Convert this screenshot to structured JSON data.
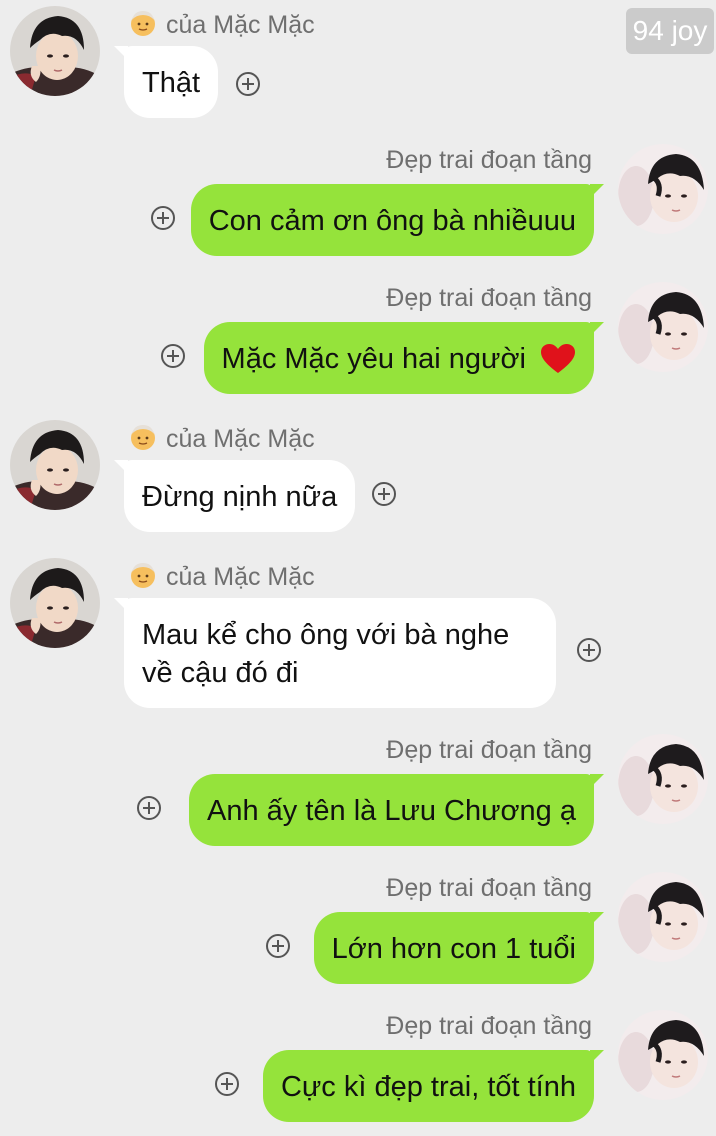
{
  "watermark": "94 joy",
  "senders": {
    "grandpa": "của Mặc Mặc",
    "me": "Đẹp trai đoạn tầng"
  },
  "icons": {
    "grandpa_emoji": "old-man-emoji",
    "heart": "red-heart-emoji",
    "plus": "add-circle-icon"
  },
  "colors": {
    "background": "#ededed",
    "incoming_bubble": "#ffffff",
    "outgoing_bubble": "#95e33b"
  },
  "messages": [
    {
      "side": "left",
      "sender": "của Mặc Mặc",
      "text": "Thật"
    },
    {
      "side": "right",
      "sender": "Đẹp trai đoạn tầng",
      "text": "Con cảm ơn ông bà nhiềuuu"
    },
    {
      "side": "right",
      "sender": "Đẹp trai đoạn tầng",
      "text": "Mặc Mặc yêu hai người"
    },
    {
      "side": "left",
      "sender": "của Mặc Mặc",
      "text": "Đừng nịnh nữa"
    },
    {
      "side": "left",
      "sender": "của Mặc Mặc",
      "text": "Mau kể cho ông với bà nghe về cậu đó đi"
    },
    {
      "side": "right",
      "sender": "Đẹp trai đoạn tầng",
      "text": "Anh ấy tên là Lưu Chương ạ"
    },
    {
      "side": "right",
      "sender": "Đẹp trai đoạn tầng",
      "text": "Lớn hơn con 1 tuổi"
    },
    {
      "side": "right",
      "sender": "Đẹp trai đoạn tầng",
      "text": "Cực kì đẹp trai, tốt tính"
    }
  ]
}
